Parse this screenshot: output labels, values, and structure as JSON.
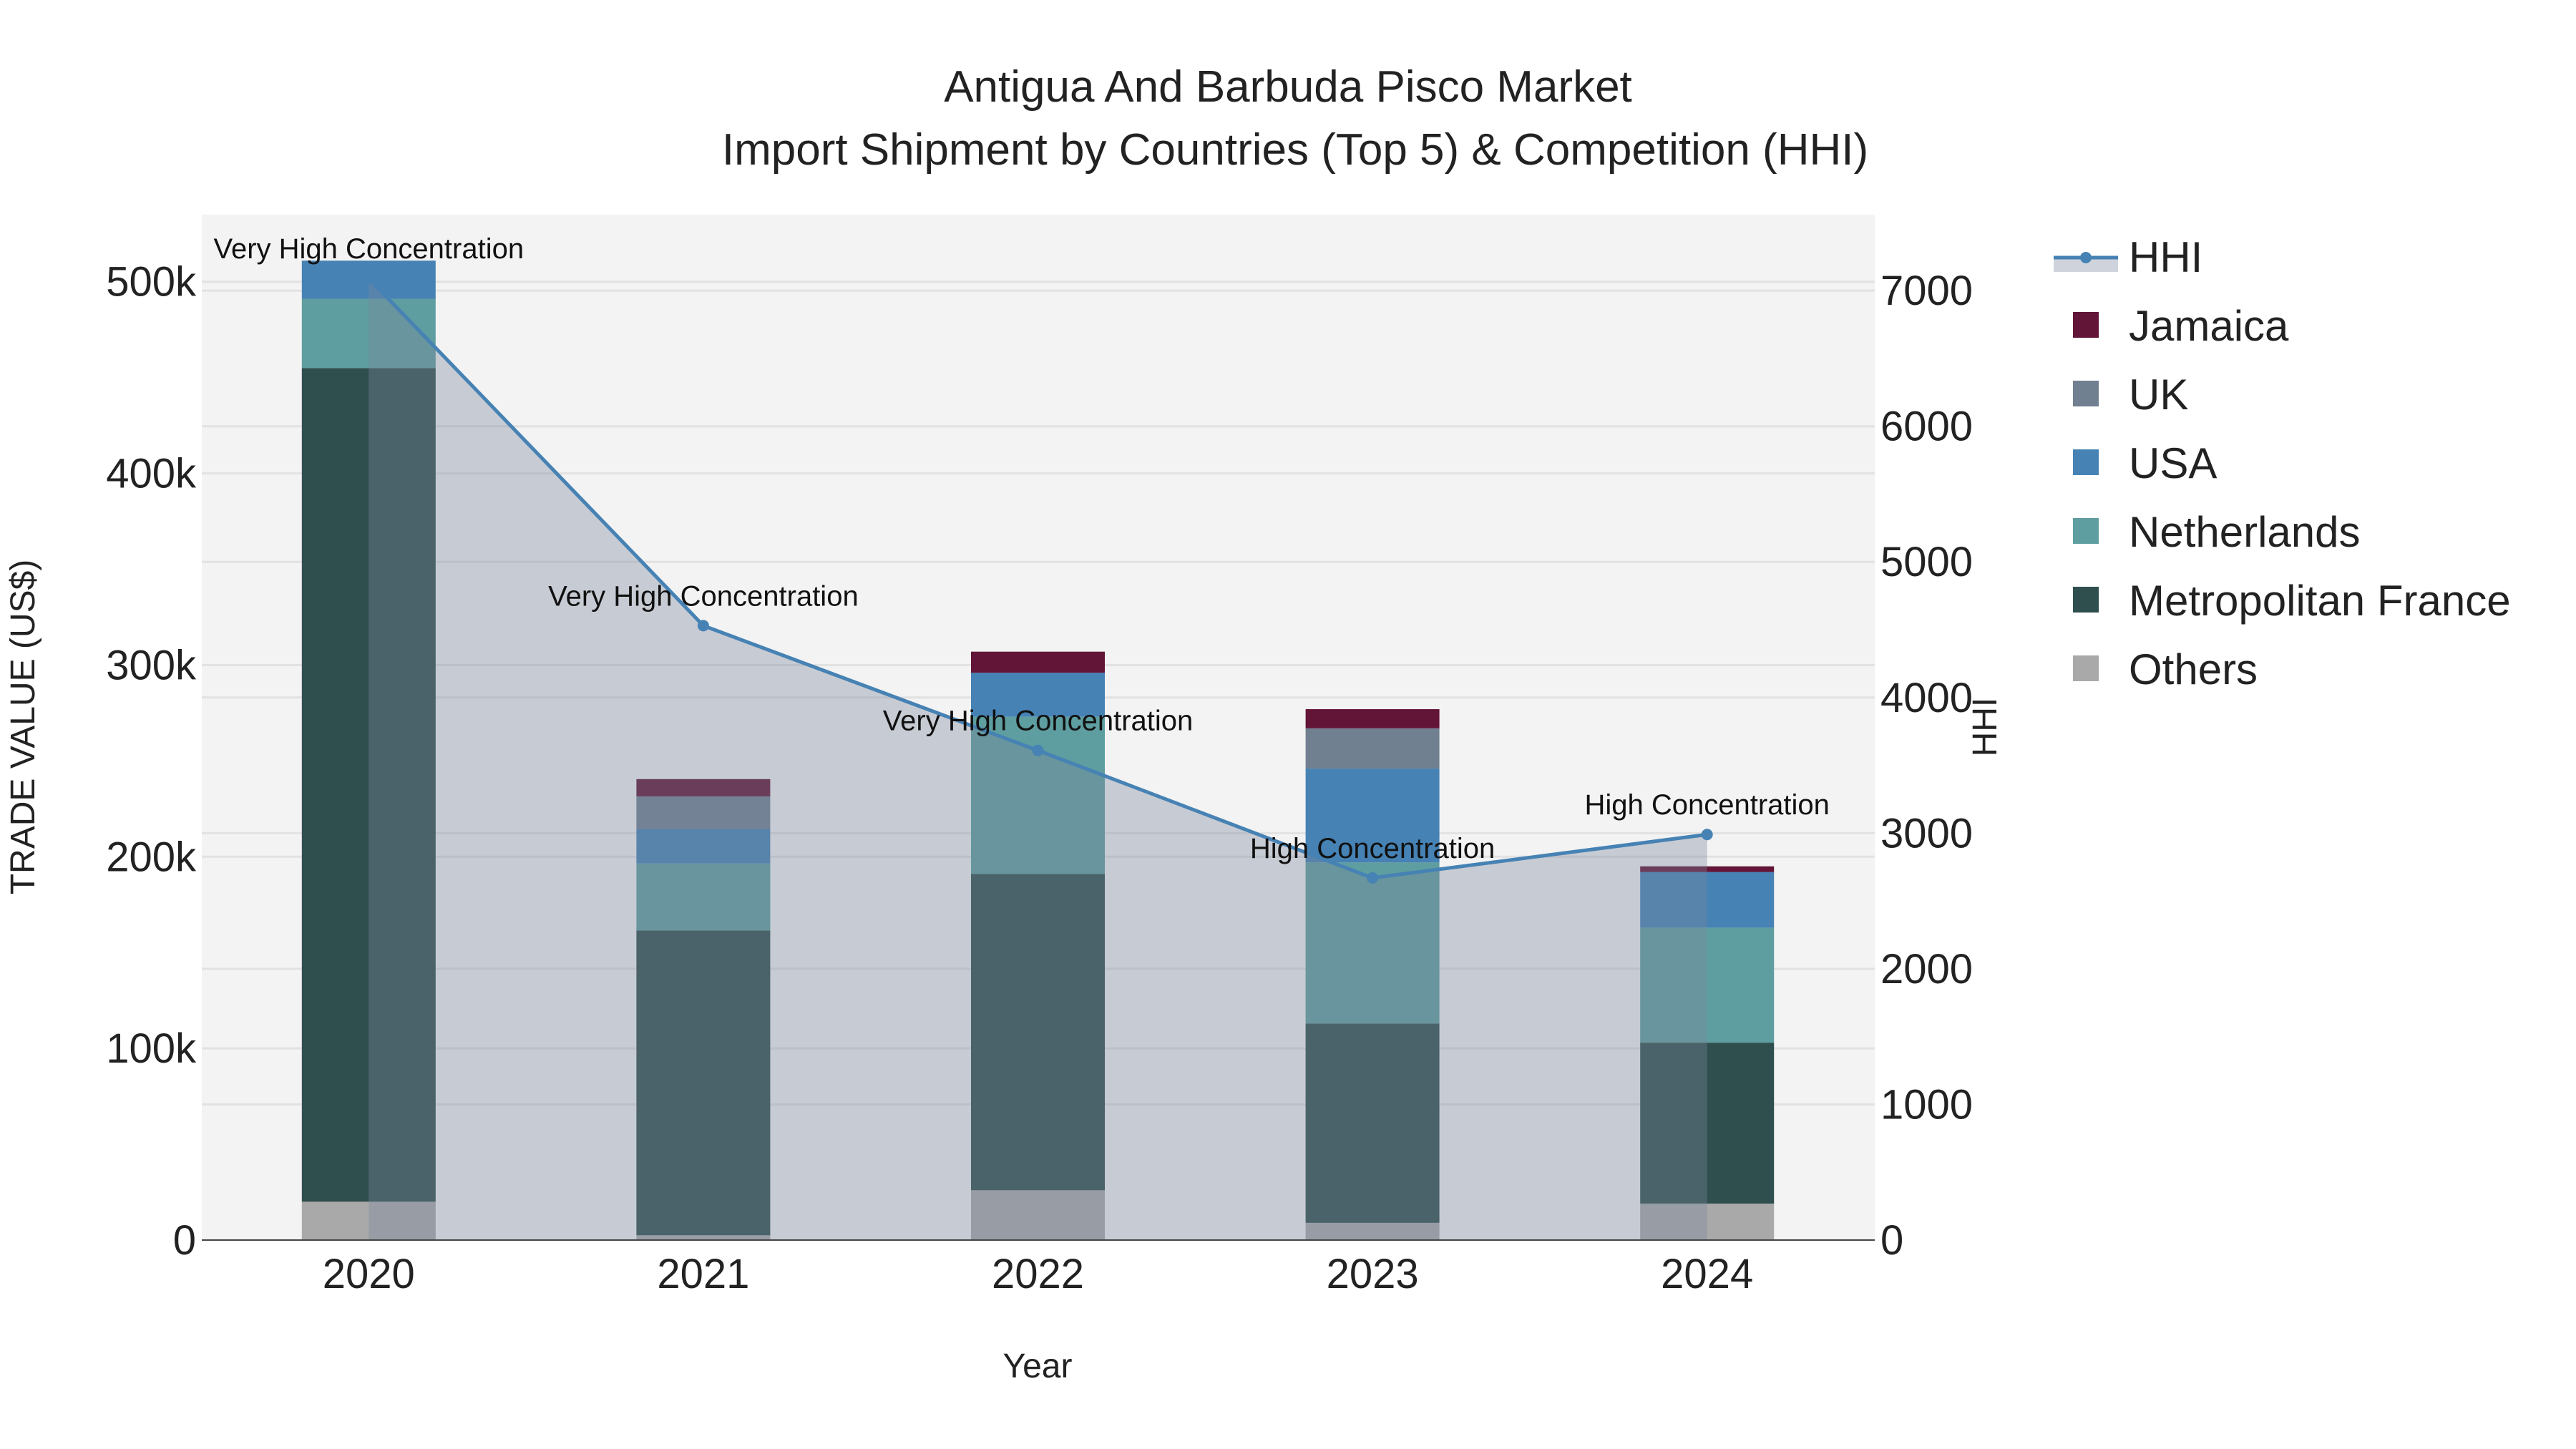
{
  "chart_data": {
    "type": "bar",
    "title": "Antigua And Barbuda Pisco Market",
    "subtitle": "Import Shipment by Countries (Top 5) & Competition (HHI)",
    "xlabel": "Year",
    "ylabel": "TRADE VALUE (US$)",
    "y2label": "HHI",
    "categories": [
      "2020",
      "2021",
      "2022",
      "2023",
      "2024"
    ],
    "ylim": [
      0,
      535000
    ],
    "y2lim": [
      0,
      7560
    ],
    "yticks": [
      0,
      100000,
      200000,
      300000,
      400000,
      500000
    ],
    "ytick_labels": [
      "0",
      "100k",
      "200k",
      "300k",
      "400k",
      "500k"
    ],
    "y2ticks": [
      0,
      1000,
      2000,
      3000,
      4000,
      5000,
      6000,
      7000
    ],
    "y2tick_labels": [
      "0",
      "1000",
      "2000",
      "3000",
      "4000",
      "5000",
      "6000",
      "7000"
    ],
    "stack_order_bottom_to_top": [
      "Others",
      "Metropolitan France",
      "Netherlands",
      "USA",
      "UK",
      "Jamaica"
    ],
    "series": [
      {
        "name": "Others",
        "color": "#a9a9a9",
        "values": [
          20000,
          2500,
          26000,
          9000,
          19000
        ]
      },
      {
        "name": "Metropolitan France",
        "color": "#2f4f4f",
        "values": [
          435000,
          159000,
          165000,
          104000,
          84000
        ]
      },
      {
        "name": "Netherlands",
        "color": "#5f9ea0",
        "values": [
          36000,
          35000,
          82000,
          84000,
          60000
        ]
      },
      {
        "name": "USA",
        "color": "#4682b4",
        "values": [
          20000,
          18000,
          23000,
          49000,
          29000
        ]
      },
      {
        "name": "UK",
        "color": "#708090",
        "values": [
          0,
          17000,
          0,
          21000,
          0
        ]
      },
      {
        "name": "Jamaica",
        "color": "#621537",
        "values": [
          0,
          9000,
          11000,
          10000,
          3000
        ]
      }
    ],
    "hhi": {
      "name": "HHI",
      "color": "#4682b4",
      "values": [
        7090,
        4530,
        3610,
        2670,
        2990
      ]
    },
    "annotations": [
      "Very High Concentration",
      "Very High Concentration",
      "Very High Concentration",
      "High Concentration",
      "High Concentration"
    ],
    "legend": [
      "HHI",
      "Jamaica",
      "UK",
      "USA",
      "Netherlands",
      "Metropolitan France",
      "Others"
    ],
    "legend_position": "right",
    "grid": true
  }
}
